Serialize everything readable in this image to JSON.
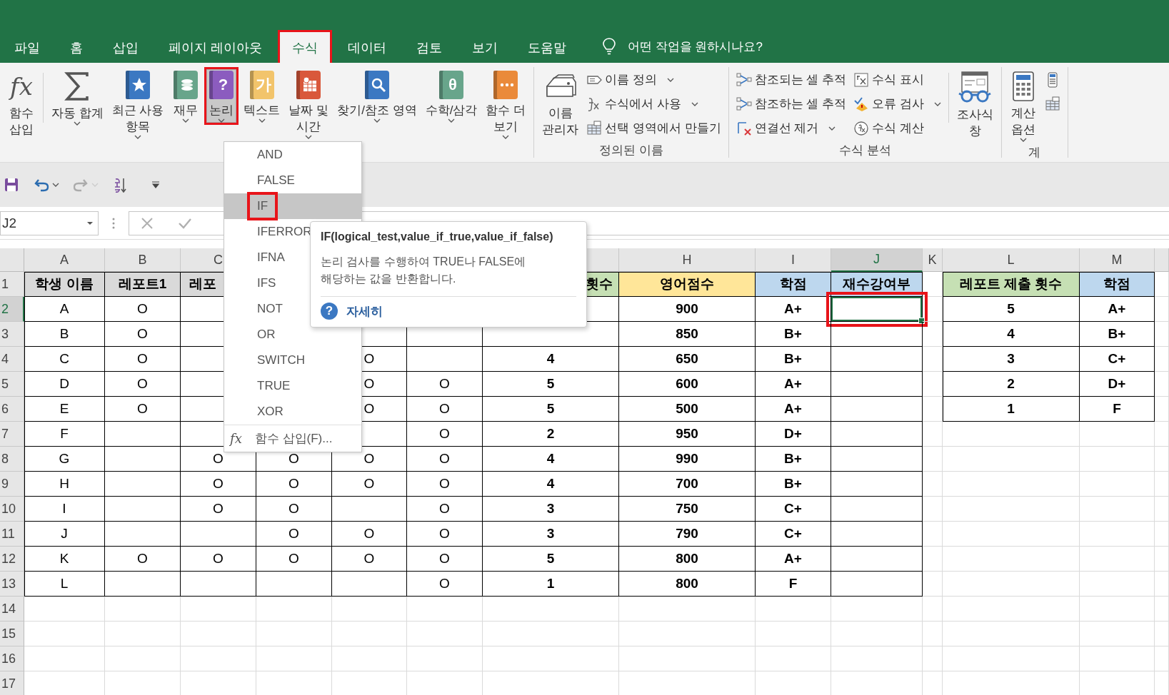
{
  "tabs": [
    {
      "label": "파일",
      "selected": false,
      "highlighted": false
    },
    {
      "label": "홈",
      "selected": false,
      "highlighted": false
    },
    {
      "label": "삽입",
      "selected": false,
      "highlighted": false
    },
    {
      "label": "페이지 레이아웃",
      "selected": false,
      "highlighted": false
    },
    {
      "label": "수식",
      "selected": true,
      "highlighted": true
    },
    {
      "label": "데이터",
      "selected": false,
      "highlighted": false
    },
    {
      "label": "검토",
      "selected": false,
      "highlighted": false
    },
    {
      "label": "보기",
      "selected": false,
      "highlighted": false
    },
    {
      "label": "도움말",
      "selected": false,
      "highlighted": false
    }
  ],
  "tell_me": {
    "placeholder": "어떤 작업을 원하시나요?"
  },
  "ribbon": {
    "groups": [
      {
        "items": [
          {
            "kind": "big",
            "label": "함수\n삽입",
            "glyph": "fx",
            "dropdown": false,
            "pressed": false,
            "highlighted": false
          },
          {
            "kind": "separator"
          },
          {
            "kind": "big",
            "label": "자동 합계",
            "dropdown": true,
            "pressed": false,
            "highlighted": false
          },
          {
            "kind": "big",
            "label": "최근 사용\n항목",
            "color": "#3b78c2",
            "dropdown": true,
            "pressed": false,
            "highlighted": false
          },
          {
            "kind": "big",
            "label": "재무",
            "color": "#68a58b",
            "dropdown": true,
            "pressed": false,
            "highlighted": false
          },
          {
            "kind": "big",
            "label": "논리",
            "color": "#8b5cbf",
            "glyph": "?",
            "dropdown": true,
            "pressed": true,
            "highlighted": true
          },
          {
            "kind": "big",
            "label": "텍스트",
            "color": "#f2c46b",
            "glyph": "가",
            "dropdown": true,
            "pressed": false,
            "highlighted": false
          },
          {
            "kind": "big",
            "label": "날짜 및\n시간",
            "color": "#d9583b",
            "dropdown": true,
            "pressed": false,
            "highlighted": false
          },
          {
            "kind": "big",
            "label": "찾기/참조 영역",
            "color": "#3b78c2",
            "dropdown": true,
            "pressed": false,
            "highlighted": false
          },
          {
            "kind": "big",
            "label": "수학/삼각",
            "color": "#68a58b",
            "glyph": "θ",
            "dropdown": true,
            "pressed": false,
            "highlighted": false
          },
          {
            "kind": "big",
            "label": "함수 더\n보기",
            "color": "#ea8a3a",
            "dropdown": true,
            "pressed": false,
            "highlighted": false
          }
        ]
      },
      {
        "label": "정의된 이름",
        "items": [
          {
            "kind": "big",
            "label": "이름\n관리자",
            "dropdown": false,
            "pressed": false,
            "highlighted": false
          },
          {
            "kind": "column",
            "buttons": [
              {
                "label": "이름 정의",
                "dropdown": true
              },
              {
                "label": "수식에서 사용",
                "dropdown": true
              },
              {
                "label": "선택 영역에서 만들기",
                "dropdown": false
              }
            ]
          }
        ]
      },
      {
        "label": "수식 분석",
        "items": [
          {
            "kind": "column",
            "buttons": [
              {
                "label": "참조되는 셀 추적",
                "dropdown": false
              },
              {
                "label": "참조하는 셀 추적",
                "dropdown": false
              },
              {
                "label": "연결선 제거",
                "dropdown": true
              }
            ]
          },
          {
            "kind": "column",
            "buttons": [
              {
                "label": "수식 표시",
                "dropdown": false
              },
              {
                "label": "오류 검사",
                "dropdown": true
              },
              {
                "label": "수식 계산",
                "dropdown": false
              }
            ]
          },
          {
            "kind": "separator"
          },
          {
            "kind": "big",
            "label": "조사식\n창",
            "dropdown": false,
            "pressed": false,
            "highlighted": false
          }
        ]
      },
      {
        "label": "계",
        "items": [
          {
            "kind": "big",
            "label": "계산\n옵션",
            "dropdown": true,
            "pressed": false,
            "highlighted": false
          },
          {
            "kind": "column",
            "buttons": [
              {
                "dropdown": false
              },
              {
                "dropdown": false
              }
            ]
          }
        ]
      }
    ]
  },
  "quick_access": [
    {
      "dropdown": false,
      "disabled": false
    },
    {
      "dropdown": true,
      "disabled": false
    },
    {
      "dropdown": true,
      "disabled": true
    },
    {
      "dropdown": false,
      "disabled": false
    }
  ],
  "formula_bar": {
    "name_box": "J2",
    "cancel_disabled": true,
    "enter_disabled": true
  },
  "sheet": {
    "active_cell_highlighted": true,
    "columns": [
      {
        "letter": "A",
        "selected": false
      },
      {
        "letter": "B",
        "selected": false
      },
      {
        "letter": "C",
        "selected": false
      },
      {},
      {},
      {},
      {
        "selected": false
      },
      {
        "letter": "H",
        "selected": false
      },
      {
        "letter": "I",
        "selected": false
      },
      {
        "letter": "J",
        "selected": true
      },
      {
        "letter": "K",
        "selected": false
      },
      {
        "letter": "L",
        "selected": false
      },
      {
        "letter": "M",
        "selected": false
      }
    ],
    "rows": [
      {
        "number": "1",
        "selected": false,
        "cells": [
          {
            "text": "학생 이름",
            "color": "#d9d9d9"
          },
          {
            "text": "레포트1",
            "color": "#d9d9d9"
          },
          {
            "text": "레포",
            "color": "#d9d9d9"
          },
          null,
          null,
          null,
          {
            "text": "횟수",
            "color": "#c6e0b4"
          },
          {
            "text": "영어점수",
            "color": "#ffe699"
          },
          {
            "text": "학점",
            "color": "#bdd7ee"
          },
          {
            "text": "재수강여부",
            "color": "#bdd7ee"
          },
          null,
          {
            "text": "레포트 제출 횟수",
            "color": "#c6e0b4"
          },
          {
            "text": "학점",
            "color": "#bdd7ee"
          }
        ]
      },
      {
        "number": "2",
        "selected": true,
        "cells": [
          "A",
          "O",
          null,
          null,
          null,
          null,
          null,
          "900",
          "A+",
          null,
          null,
          "5",
          "A+"
        ]
      },
      {
        "number": "3",
        "selected": false,
        "cells": [
          "B",
          "O",
          null,
          null,
          null,
          null,
          null,
          "850",
          "B+",
          null,
          null,
          "4",
          "B+"
        ]
      },
      {
        "number": "4",
        "selected": false,
        "cells": [
          "C",
          "O",
          null,
          null,
          "O",
          null,
          "4",
          "650",
          "B+",
          null,
          null,
          "3",
          "C+"
        ]
      },
      {
        "number": "5",
        "selected": false,
        "cells": [
          "D",
          "O",
          null,
          null,
          "O",
          "O",
          "5",
          "600",
          "A+",
          null,
          null,
          "2",
          "D+"
        ]
      },
      {
        "number": "6",
        "selected": false,
        "cells": [
          "E",
          "O",
          null,
          null,
          "O",
          "O",
          "5",
          "500",
          "A+",
          null,
          null,
          "1",
          "F"
        ]
      },
      {
        "number": "7",
        "selected": false,
        "cells": [
          "F",
          null,
          null,
          null,
          null,
          "O",
          "2",
          "950",
          "D+",
          null,
          null,
          null,
          null
        ]
      },
      {
        "number": "8",
        "selected": false,
        "cells": [
          "G",
          null,
          "O",
          "O",
          "O",
          "O",
          "4",
          "990",
          "B+",
          null,
          null,
          null,
          null
        ]
      },
      {
        "number": "9",
        "selected": false,
        "cells": [
          "H",
          null,
          "O",
          "O",
          "O",
          "O",
          "4",
          "700",
          "B+",
          null,
          null,
          null,
          null
        ]
      },
      {
        "number": "10",
        "selected": false,
        "cells": [
          "I",
          null,
          "O",
          "O",
          null,
          "O",
          "3",
          "750",
          "C+",
          null,
          null,
          null,
          null
        ]
      },
      {
        "number": "11",
        "selected": false,
        "cells": [
          "J",
          null,
          null,
          "O",
          "O",
          "O",
          "3",
          "790",
          "C+",
          null,
          null,
          null,
          null
        ]
      },
      {
        "number": "12",
        "selected": false,
        "cells": [
          "K",
          "O",
          "O",
          "O",
          "O",
          "O",
          "5",
          "800",
          "A+",
          null,
          null,
          null,
          null
        ]
      },
      {
        "number": "13",
        "selected": false,
        "cells": [
          "L",
          null,
          null,
          null,
          null,
          "O",
          "1",
          "800",
          "F",
          null,
          null,
          null,
          null
        ]
      },
      {
        "number": "14",
        "selected": false
      },
      {
        "number": "15",
        "selected": false
      },
      {
        "number": "16",
        "selected": false
      },
      {
        "number": "17",
        "selected": false
      }
    ]
  },
  "dropdown": {
    "items": [
      {
        "label": "AND",
        "selected": false,
        "highlighted": false
      },
      {
        "label": "FALSE",
        "selected": false,
        "highlighted": false
      },
      {
        "label": "IF",
        "selected": true,
        "highlighted": true
      },
      {
        "label": "IFERROR",
        "selected": false,
        "highlighted": false
      },
      {
        "label": "IFNA",
        "selected": false,
        "highlighted": false
      },
      {
        "label": "IFS",
        "selected": false,
        "highlighted": false
      },
      {
        "label": "NOT",
        "selected": false,
        "highlighted": false
      },
      {
        "label": "OR",
        "selected": false,
        "highlighted": false
      },
      {
        "label": "SWITCH",
        "selected": false,
        "highlighted": false
      },
      {
        "label": "TRUE",
        "selected": false,
        "highlighted": false
      },
      {
        "label": "XOR",
        "selected": false,
        "highlighted": false
      }
    ],
    "footer": {
      "glyph": "fx",
      "label": "함수 삽입(F)..."
    }
  },
  "tooltip": {
    "title": "IF(logical_test,value_if_true,value_if_false)",
    "description": "논리 검사를 수행하여 TRUE나 FALSE에\n해당하는 값을 반환합니다.",
    "link_glyph": "?",
    "link": "자세히"
  }
}
